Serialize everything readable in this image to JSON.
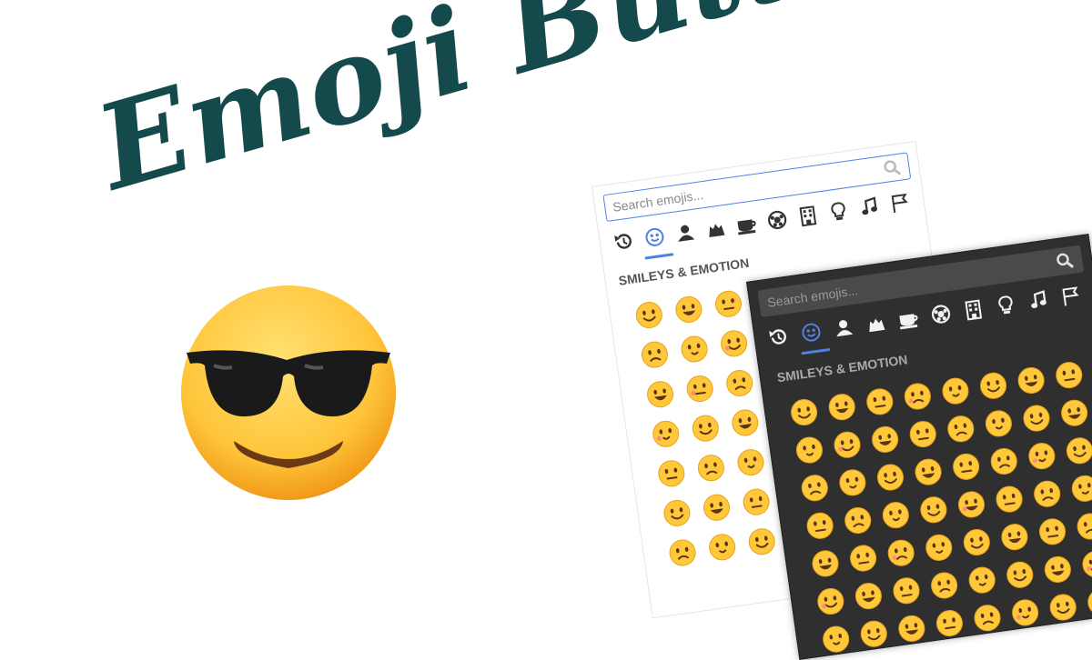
{
  "title": "Emoji Button",
  "hero_emoji": "smiling-face-with-sunglasses",
  "colors": {
    "title": "#154a4d",
    "accent": "#4f81e5",
    "emoji_face": "#ffc83a",
    "dark_bg": "#2f2f2f"
  },
  "light_picker": {
    "search_placeholder": "Search emojis...",
    "category_title": "SMILEYS & EMOTION",
    "categories": [
      "recents-icon",
      "smileys-icon",
      "people-icon",
      "animals-icon",
      "food-icon",
      "activities-icon",
      "travel-icon",
      "objects-icon",
      "symbols-icon",
      "flags-icon"
    ],
    "active_category": "smileys-icon"
  },
  "dark_picker": {
    "search_placeholder": "Search emojis...",
    "category_title": "SMILEYS & EMOTION",
    "categories": [
      "recents-icon",
      "smileys-icon",
      "people-icon",
      "animals-icon",
      "food-icon",
      "activities-icon",
      "travel-icon",
      "objects-icon",
      "symbols-icon",
      "flags-icon"
    ],
    "active_category": "smileys-icon"
  }
}
